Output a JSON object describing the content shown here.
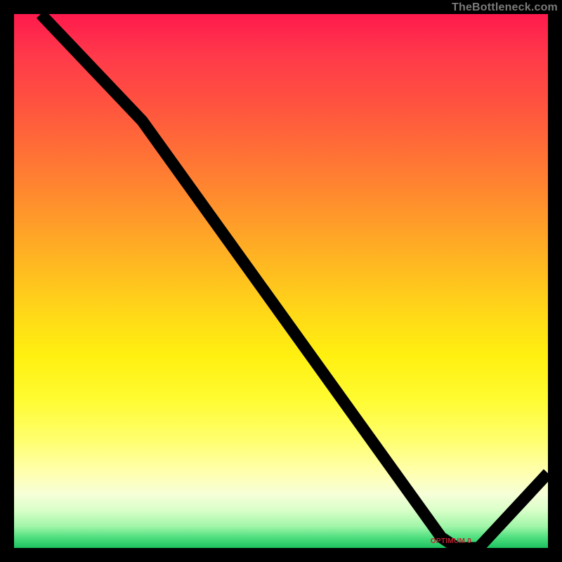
{
  "attribution": "TheBottleneck.com",
  "floor_label": "OPTIMUM 0",
  "floor_label_left_pct": 78,
  "chart_data": {
    "type": "line",
    "title": "",
    "xlabel": "",
    "ylabel": "",
    "xlim": [
      0,
      100
    ],
    "ylim": [
      0,
      100
    ],
    "grid": false,
    "series": [
      {
        "name": "bottleneck-curve",
        "points": [
          {
            "x": 5,
            "y": 100
          },
          {
            "x": 24,
            "y": 80
          },
          {
            "x": 80,
            "y": 2
          },
          {
            "x": 83,
            "y": 0
          },
          {
            "x": 87,
            "y": 0
          },
          {
            "x": 100,
            "y": 14
          }
        ]
      }
    ],
    "annotations": [
      {
        "text": "OPTIMUM 0",
        "x": 83,
        "y": 0
      }
    ]
  },
  "colors": {
    "frame": "#000000",
    "line": "#000000",
    "gradient_top": "#ff1a4d",
    "gradient_bottom": "#1cc060",
    "attribution": "#7a7a7a",
    "floor_label": "#c02030"
  }
}
